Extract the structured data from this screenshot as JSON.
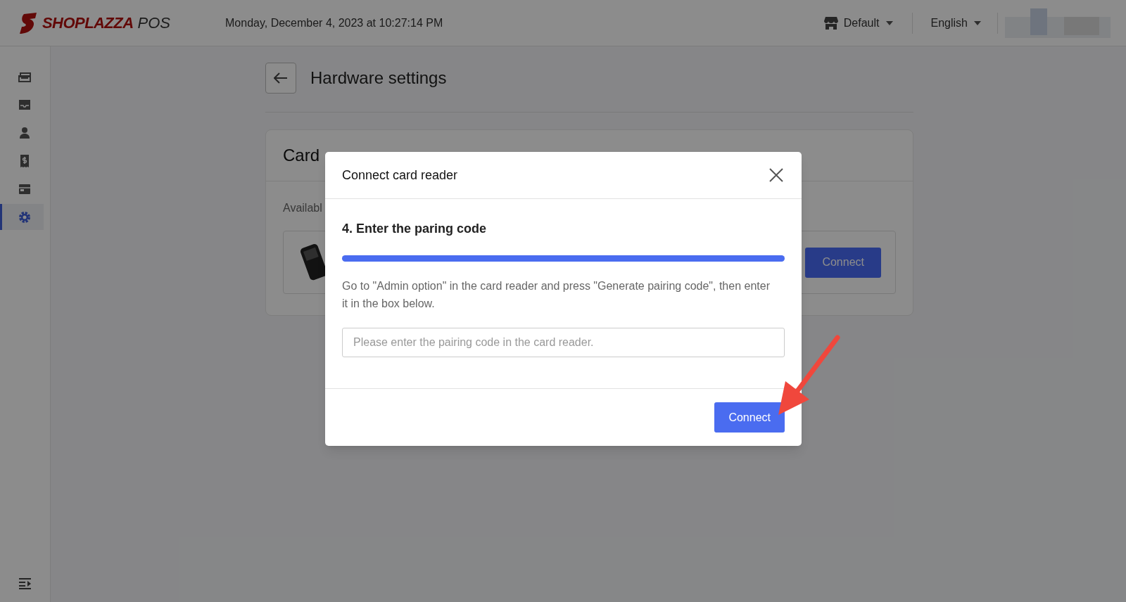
{
  "header": {
    "logo": {
      "brand": "SHOPLAZZA",
      "suffix": "POS"
    },
    "datetime": "Monday, December 4, 2023 at 10:27:14 PM",
    "store": {
      "label": "Default"
    },
    "language": {
      "label": "English"
    }
  },
  "sidebar": {
    "items": [
      {
        "kind": "register",
        "selected": false
      },
      {
        "kind": "inbox",
        "selected": false
      },
      {
        "kind": "customer",
        "selected": false
      },
      {
        "kind": "receipt",
        "selected": false
      },
      {
        "kind": "wallet",
        "selected": false
      },
      {
        "kind": "settings",
        "selected": true
      }
    ]
  },
  "page": {
    "title": "Hardware settings",
    "card": {
      "title": "Card",
      "subtitle": "Availabl",
      "device_button": "Connect"
    }
  },
  "modal": {
    "title": "Connect card reader",
    "step": "4. Enter the paring code",
    "progress": {
      "level": 1
    },
    "instructions": "Go to \"Admin option\" in the card reader and press \"Generate pairing code\", then enter it in the box below.",
    "input": {
      "placeholder": "Please enter the pairing code in the card reader."
    },
    "button": "Connect"
  }
}
